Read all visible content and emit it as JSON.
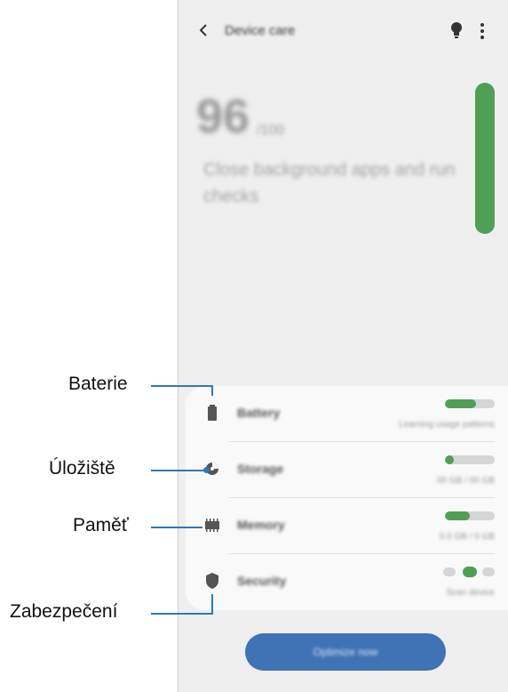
{
  "header": {
    "title": "Device care"
  },
  "score": {
    "value": "96",
    "unit": "/100"
  },
  "headline": "Close background apps and run checks",
  "items": [
    {
      "label": "Battery",
      "detail": "Learning usage patterns",
      "bar": 0.62
    },
    {
      "label": "Storage",
      "detail": "00 GB / 00 GB",
      "bar": 0.18
    },
    {
      "label": "Memory",
      "detail": "0.0 GB / 0 GB",
      "bar": 0.5
    },
    {
      "label": "Security",
      "detail": "Scan device",
      "status_dot_active_index": 1
    }
  ],
  "optimize_label": "Optimize now",
  "callouts": {
    "battery": "Baterie",
    "storage": "Úložiště",
    "memory": "Paměť",
    "security": "Zabezpečení"
  },
  "colors": {
    "accent_green": "#4f9f57",
    "button_blue": "#3f73b5",
    "callout_blue": "#2f78b7"
  }
}
